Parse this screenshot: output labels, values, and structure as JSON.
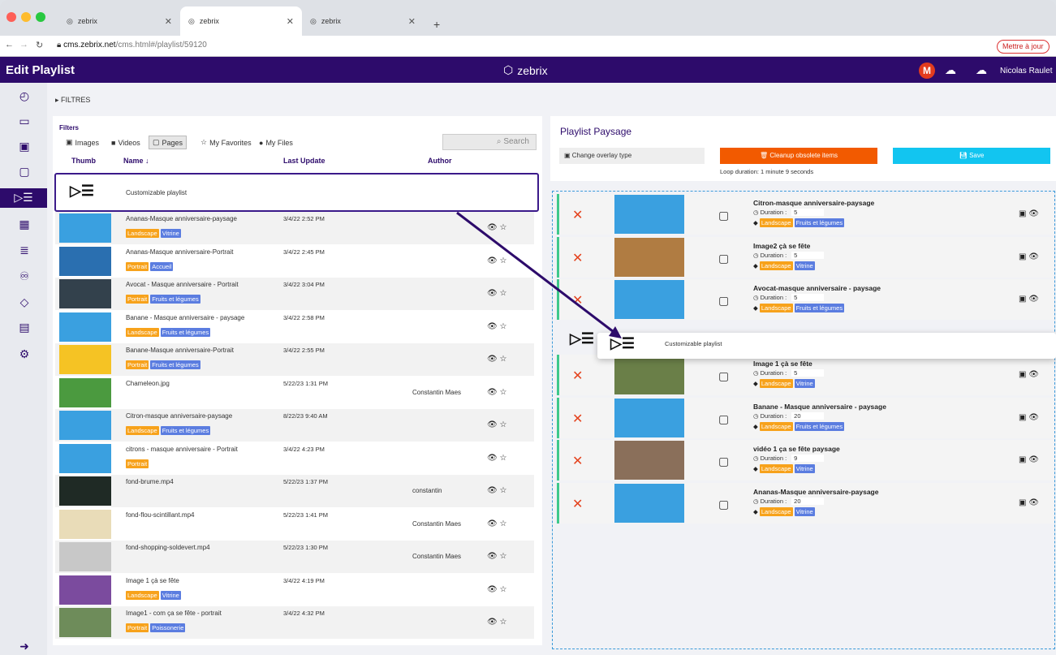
{
  "browser": {
    "tabs": [
      {
        "label": "zebrix"
      },
      {
        "label": "zebrix"
      },
      {
        "label": "zebrix"
      }
    ],
    "url_host": "cms.zebrix.net",
    "url_path": "/cms.html#/playlist/59120",
    "update_label": "Mettre à jour"
  },
  "header": {
    "title": "Edit Playlist",
    "brand": "zebrix",
    "avatar_letter": "M",
    "user": "Nicolas Raulet"
  },
  "filtres": "▸ FILTRES",
  "library": {
    "filters_label": "Filters",
    "filter_buttons": [
      "Images",
      "Videos",
      "Pages",
      "My Favorites",
      "My Files"
    ],
    "search_placeholder": "Search",
    "columns": {
      "thumb": "Thumb",
      "name": "Name ↓",
      "last_update": "Last Update",
      "author": "Author"
    },
    "custom_playlist": "Customizable playlist",
    "rows": [
      {
        "name": "Ananas-Masque anniversaire-paysage",
        "date": "3/4/22 2:52 PM",
        "author": "",
        "tags": [
          "Landscape",
          "Vitrine"
        ]
      },
      {
        "name": "Ananas-Masque anniversaire-Portrait",
        "date": "3/4/22 2:45 PM",
        "author": "",
        "tags": [
          "Portrait",
          "Accueil"
        ]
      },
      {
        "name": "Avocat - Masque anniversaire - Portrait",
        "date": "3/4/22 3:04 PM",
        "author": "",
        "tags": [
          "Portrait",
          "Fruits et légumes"
        ]
      },
      {
        "name": "Banane - Masque anniversaire - paysage",
        "date": "3/4/22 2:58 PM",
        "author": "",
        "tags": [
          "Landscape",
          "Fruits et légumes"
        ]
      },
      {
        "name": "Banane-Masque anniversaire-Portrait",
        "date": "3/4/22 2:55 PM",
        "author": "",
        "tags": [
          "Portrait",
          "Fruits et légumes"
        ]
      },
      {
        "name": "Chameleon.jpg",
        "date": "5/22/23 1:31 PM",
        "author": "Constantin Maes",
        "tags": []
      },
      {
        "name": "Citron-masque anniversaire-paysage",
        "date": "8/22/23 9:40 AM",
        "author": "",
        "tags": [
          "Landscape",
          "Fruits et légumes"
        ]
      },
      {
        "name": "citrons - masque anniversaire - Portrait",
        "date": "3/4/22 4:23 PM",
        "author": "",
        "tags": [
          "Portrait"
        ]
      },
      {
        "name": "fond-brume.mp4",
        "date": "5/22/23 1:37 PM",
        "author": "constantin",
        "tags": []
      },
      {
        "name": "fond-flou-scintillant.mp4",
        "date": "5/22/23 1:41 PM",
        "author": "Constantin Maes",
        "tags": []
      },
      {
        "name": "fond-shopping-soldevert.mp4",
        "date": "5/22/23 1:30 PM",
        "author": "Constantin Maes",
        "tags": []
      },
      {
        "name": "Image 1 çà se fête",
        "date": "3/4/22 4:19 PM",
        "author": "",
        "tags": [
          "Landscape",
          "Vitrine"
        ]
      },
      {
        "name": "Image1 - com ça se fête - portrait",
        "date": "3/4/22 4:32 PM",
        "author": "",
        "tags": [
          "Portrait",
          "Poissonerie"
        ]
      }
    ]
  },
  "playlist": {
    "title": "Playlist Paysage",
    "overlay_label": "Change overlay type",
    "cleanup_label": "Cleanup obsolete items",
    "save_label": "Save",
    "loop": "Loop duration: 1 minute 9 seconds",
    "duration_label": "Duration :",
    "items": [
      {
        "title": "Citron-masque anniversaire-paysage",
        "duration": "5",
        "tags": [
          "Landscape",
          "Fruits et légumes"
        ]
      },
      {
        "title": "Image2 çà se fête",
        "duration": "5",
        "tags": [
          "Landscape",
          "Vitrine"
        ]
      },
      {
        "title": "Avocat-masque anniversaire - paysage",
        "duration": "5",
        "tags": [
          "Landscape",
          "Fruits et légumes"
        ]
      },
      {
        "title": "Image 1 çà se fête",
        "duration": "5",
        "tags": [
          "Landscape",
          "Vitrine"
        ]
      },
      {
        "title": "Banane - Masque anniversaire - paysage",
        "duration": "20",
        "tags": [
          "Landscape",
          "Fruits et légumes"
        ]
      },
      {
        "title": "vidéo 1 ça se fête paysage",
        "duration": "9",
        "tags": [
          "Landscape",
          "Vitrine"
        ]
      },
      {
        "title": "Ananas-Masque anniversaire-paysage",
        "duration": "20",
        "tags": [
          "Landscape",
          "Vitrine"
        ]
      }
    ],
    "drag_label": "Customizable playlist"
  },
  "colors": {
    "brand": "#2d0b6b",
    "landscape": "#f7a21b",
    "category": "#5b7de0",
    "cleanup": "#f25a00",
    "save": "#12c5f0"
  }
}
